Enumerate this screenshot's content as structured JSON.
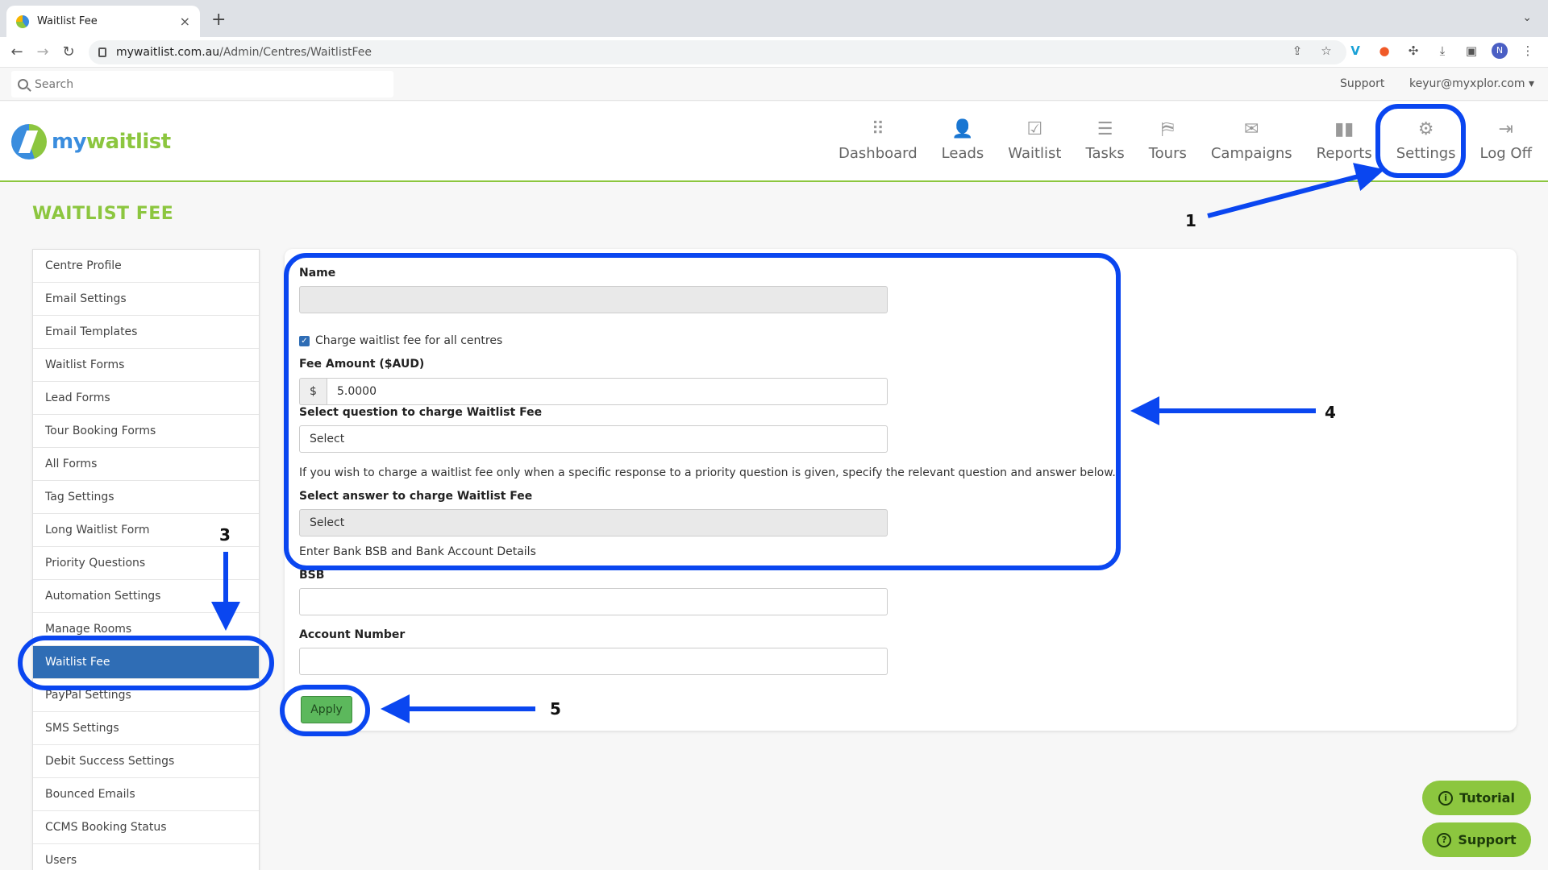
{
  "browser": {
    "tab_title": "Waitlist Fee",
    "tab_close": "×",
    "new_tab": "+",
    "url_host": "mywaitlist.com.au",
    "url_path": "/Admin/Centres/WaitlistFee",
    "profile_initial": "N"
  },
  "topbar": {
    "search_placeholder": "Search",
    "support_link": "Support",
    "user_email": "keyur@myxplor.com"
  },
  "logo": {
    "text_a": "my",
    "text_b": "waitlist"
  },
  "nav": [
    {
      "label": "Dashboard",
      "icon": "dashboard-icon"
    },
    {
      "label": "Leads",
      "icon": "add-user-icon"
    },
    {
      "label": "Waitlist",
      "icon": "inbox-check-icon"
    },
    {
      "label": "Tasks",
      "icon": "list-icon"
    },
    {
      "label": "Tours",
      "icon": "map-icon"
    },
    {
      "label": "Campaigns",
      "icon": "mail-check-icon"
    },
    {
      "label": "Reports",
      "icon": "bar-chart-icon"
    },
    {
      "label": "Settings",
      "icon": "gear-icon"
    },
    {
      "label": "Log Off",
      "icon": "logout-icon"
    }
  ],
  "page": {
    "title": "WAITLIST FEE"
  },
  "sidebar": {
    "items": [
      "Centre Profile",
      "Email Settings",
      "Email Templates",
      "Waitlist Forms",
      "Lead Forms",
      "Tour Booking Forms",
      "All Forms",
      "Tag Settings",
      "Long Waitlist Form",
      "Priority Questions",
      "Automation Settings",
      "Manage Rooms",
      "Waitlist Fee",
      "PayPal Settings",
      "SMS Settings",
      "Debit Success Settings",
      "Bounced Emails",
      "CCMS Booking Status",
      "Users"
    ],
    "active_index": 12
  },
  "form": {
    "name_label": "Name",
    "name_value": "",
    "charge_all_label": "Charge waitlist fee for all centres",
    "charge_all_checked": true,
    "fee_label": "Fee Amount ($AUD)",
    "fee_prefix": "$",
    "fee_value": "5.0000",
    "question_label": "Select question to charge Waitlist Fee",
    "question_value": "Select",
    "help_text": "If you wish to charge a waitlist fee only when a specific response to a priority question is given, specify the relevant question and answer below.",
    "answer_label": "Select answer to charge Waitlist Fee",
    "answer_value": "Select",
    "bank_text": "Enter Bank BSB and Bank Account Details",
    "bsb_label": "BSB",
    "bsb_value": "",
    "account_label": "Account Number",
    "account_value": "",
    "apply_label": "Apply"
  },
  "annotations": {
    "n1": "1",
    "n3": "3",
    "n4": "4",
    "n5": "5",
    "color": "#0a46f0"
  },
  "floating": {
    "tutorial": "Tutorial",
    "support": "Support"
  },
  "colors": {
    "brand_green": "#8cc63f",
    "brand_blue": "#3a8dde",
    "active_blue": "#2f6db5",
    "apply_green": "#5cb85c"
  }
}
